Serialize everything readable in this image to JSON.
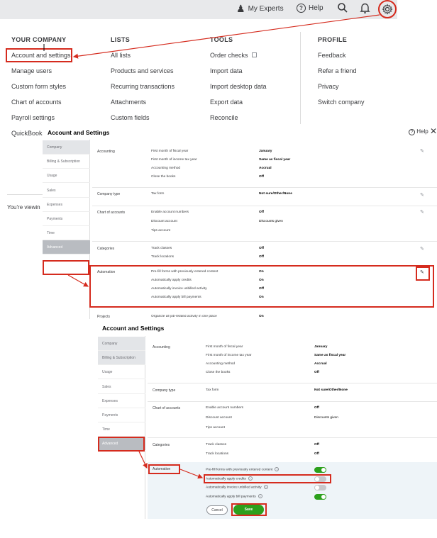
{
  "topbar": {
    "my_experts": "My Experts",
    "help": "Help"
  },
  "menu": {
    "your_company": {
      "heading": "YOUR COMPANY",
      "items": [
        "Account and settings",
        "Manage users",
        "Custom form styles",
        "Chart of accounts",
        "Payroll settings",
        "QuickBooks"
      ]
    },
    "lists": {
      "heading": "LISTS",
      "items": [
        "All lists",
        "Products and services",
        "Recurring transactions",
        "Attachments",
        "Custom fields"
      ]
    },
    "tools": {
      "heading": "TOOLS",
      "items": [
        "Order checks",
        "Import data",
        "Import desktop data",
        "Export data",
        "Reconcile"
      ]
    },
    "profile": {
      "heading": "PROFILE",
      "items": [
        "Feedback",
        "Refer a friend",
        "Privacy",
        "Switch company"
      ]
    }
  },
  "behind": {
    "viewing": "You're viewin"
  },
  "panel1": {
    "title": "Account and Settings",
    "help": "Help",
    "sidebar": [
      "Company",
      "Billing & Subscription",
      "Usage",
      "Sales",
      "Expenses",
      "Payments",
      "Time",
      "Advanced"
    ],
    "accounting": {
      "label": "Accounting",
      "fields": [
        "First month of fiscal year",
        "First month of income tax year",
        "Accounting method",
        "Close the books"
      ],
      "values": [
        "January",
        "Same as fiscal year",
        "Accrual",
        "Off"
      ]
    },
    "company_type": {
      "label": "Company type",
      "fields": [
        "Tax form"
      ],
      "values": [
        "Not sure/Other/None"
      ]
    },
    "chart_of_accounts": {
      "label": "Chart of accounts",
      "fields": [
        "Enable account numbers",
        "Discount account",
        "Tips account"
      ],
      "values": [
        "Off",
        "Discounts given"
      ]
    },
    "categories": {
      "label": "Categories",
      "fields": [
        "Track classes",
        "Track locations"
      ],
      "values": [
        "Off",
        "Off"
      ]
    },
    "automation": {
      "label": "Automation",
      "fields": [
        "Pre-fill forms with previously entered content",
        "Automatically apply credits",
        "Automatically invoice unbilled activity",
        "Automatically apply bill payments"
      ],
      "values": [
        "On",
        "On",
        "Off",
        "On"
      ]
    },
    "projects": {
      "label": "Projects",
      "fields": [
        "Organize all job-related activity in one place"
      ],
      "values": [
        "On"
      ]
    }
  },
  "panel2": {
    "title": "Account and Settings",
    "sidebar": [
      "Company",
      "Billing & Subscription",
      "Usage",
      "Sales",
      "Expenses",
      "Payments",
      "Time",
      "Advanced"
    ],
    "accounting": {
      "label": "Accounting",
      "fields": [
        "First month of fiscal year",
        "First month of income tax year",
        "Accounting method",
        "Close the books"
      ],
      "values": [
        "January",
        "Same as fiscal year",
        "Accrual",
        "Off"
      ]
    },
    "company_type": {
      "label": "Company type",
      "fields": [
        "Tax form"
      ],
      "values": [
        "Not sure/Other/None"
      ]
    },
    "chart_of_accounts": {
      "label": "Chart of accounts",
      "fields": [
        "Enable account numbers",
        "Discount account",
        "Tips account"
      ],
      "values": [
        "Off",
        "Discounts given"
      ]
    },
    "categories": {
      "label": "Categories",
      "fields": [
        "Track classes",
        "Track locations"
      ],
      "values": [
        "Off",
        "Off"
      ]
    },
    "automation": {
      "label": "Automation",
      "fields": [
        "Pre-fill forms with previously entered content",
        "Automatically apply credits",
        "Automatically invoice unbilled activity",
        "Automatically apply bill payments"
      ],
      "toggles": [
        true,
        false,
        false,
        true
      ]
    },
    "cancel_label": "Cancel",
    "save_label": "Save"
  },
  "colors": {
    "highlight": "#d52b1e",
    "accent_green": "#2ca01c",
    "topbar_bg": "#e8e9eb"
  },
  "icons": [
    "person-icon",
    "help-icon",
    "search-icon",
    "bell-icon",
    "gear-icon",
    "external-link-icon",
    "pencil-icon",
    "close-icon",
    "info-icon"
  ]
}
